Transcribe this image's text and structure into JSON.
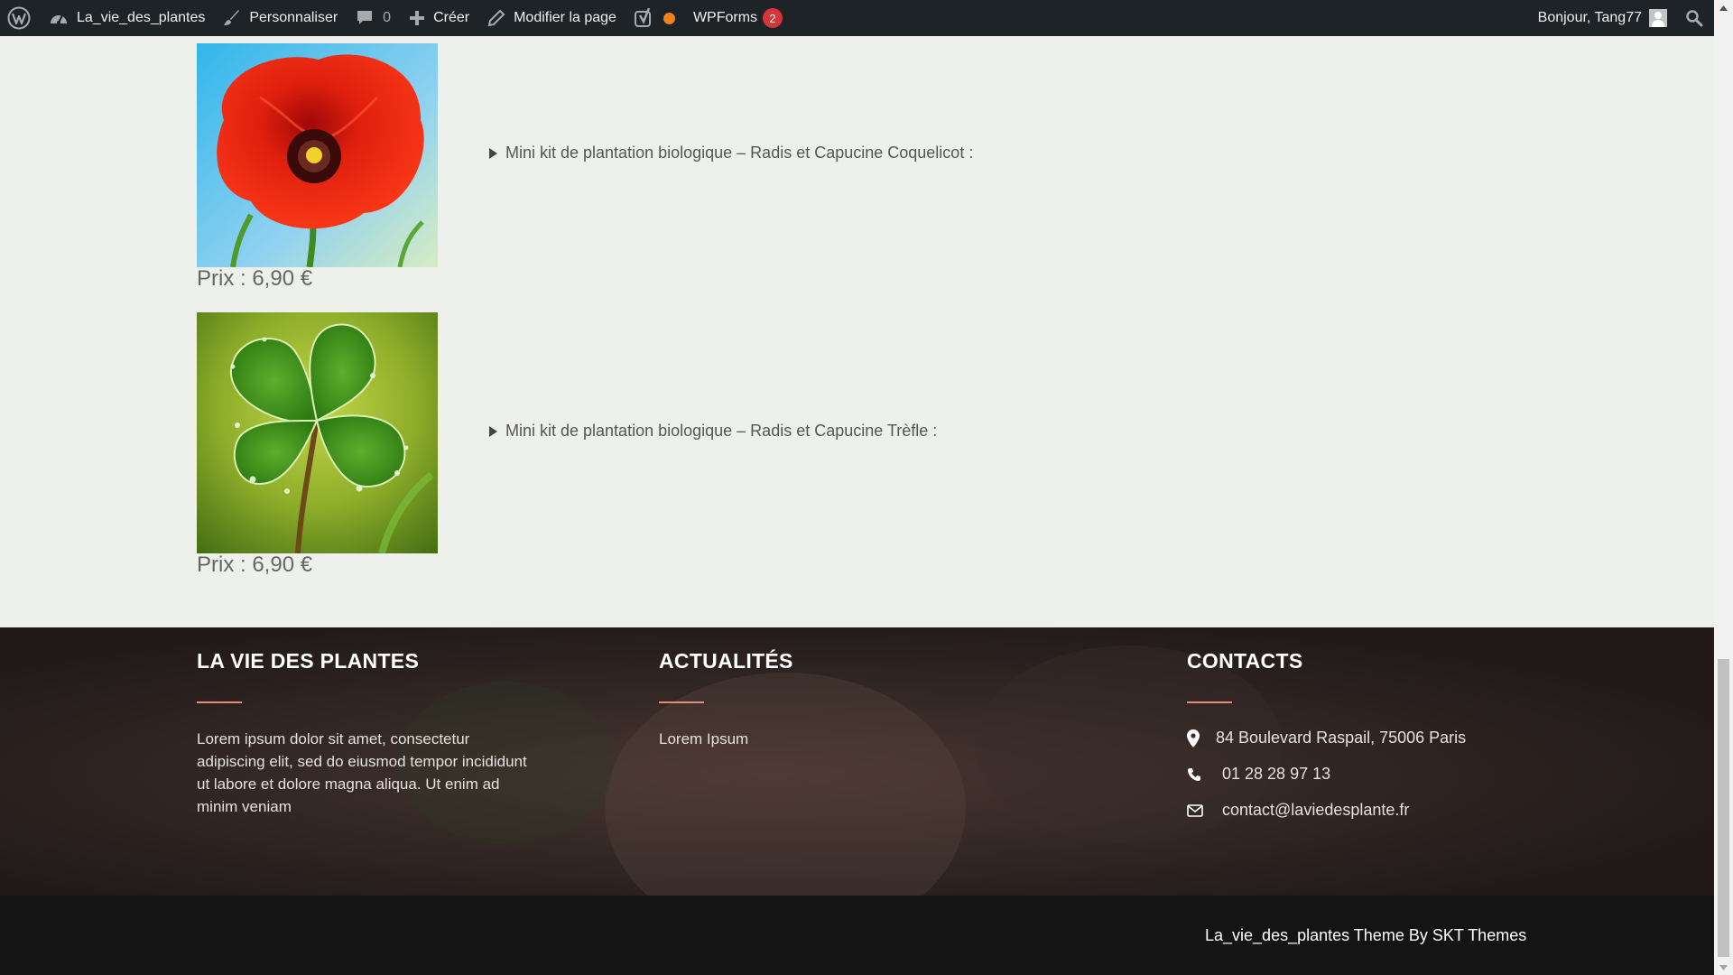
{
  "admin_bar": {
    "site_name": "La_vie_des_plantes",
    "customize": "Personnaliser",
    "comments_count": "0",
    "create": "Créer",
    "edit_page": "Modifier la page",
    "wpforms": "WPForms",
    "wpforms_badge": "2",
    "greeting": "Bonjour, Tang77",
    "seo_status_color": "#f0821e",
    "icons": [
      "wordpress-logo-icon",
      "dashboard-icon",
      "brush-icon",
      "comment-icon",
      "plus-icon",
      "pencil-icon",
      "yoast-icon",
      "search-icon"
    ]
  },
  "products": [
    {
      "image": "red-poppy-flower",
      "description": "Mini kit de plantation biologique – Radis et Capucine Coquelicot :",
      "price": "Prix : 6,90 €"
    },
    {
      "image": "four-leaf-clover",
      "description": "Mini kit de plantation biologique – Radis et Capucine Trèfle :",
      "price": "Prix : 6,90 €"
    }
  ],
  "footer": {
    "about": {
      "title": "LA VIE DES PLANTES",
      "text": "Lorem ipsum dolor sit amet, consectetur adipiscing elit, sed do eiusmod tempor incididunt ut labore et dolore magna aliqua. Ut enim ad minim veniam"
    },
    "news": {
      "title": "ACTUALITÉS",
      "link": "Lorem Ipsum"
    },
    "contacts": {
      "title": "CONTACTS",
      "address": "84 Boulevard Raspail, 75006 Paris",
      "phone": "01 28 28 97 13",
      "email": "contact@laviedesplante.fr"
    },
    "accent_color": "#e58a7d",
    "credit": "La_vie_des_plantes Theme By SKT Themes"
  }
}
